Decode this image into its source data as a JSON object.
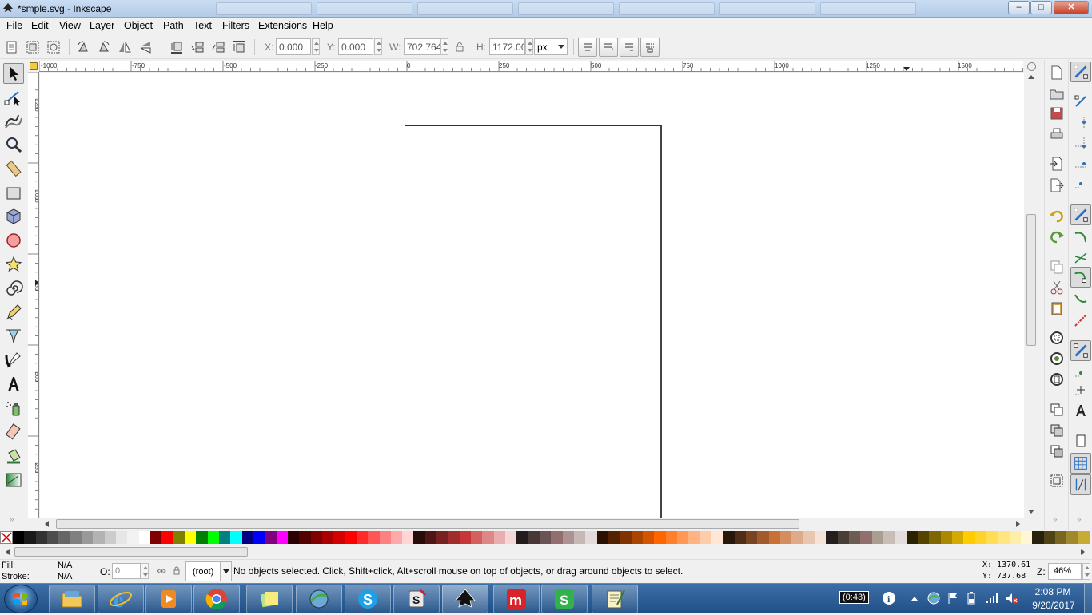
{
  "window": {
    "title": "*smple.svg - Inkscape",
    "controls": {
      "minimize": "–",
      "maximize": "□",
      "close": "✕"
    }
  },
  "menu": [
    "File",
    "Edit",
    "View",
    "Layer",
    "Object",
    "Path",
    "Text",
    "Filters",
    "Extensions",
    "Help"
  ],
  "toolbar": {
    "x_label": "X:",
    "x_value": "0.000",
    "y_label": "Y:",
    "y_value": "0.000",
    "w_label": "W:",
    "w_value": "702.764",
    "h_label": "H:",
    "h_value": "1172.00",
    "unit": "px"
  },
  "ruler": {
    "top_ticks": [
      "-1000",
      "-750",
      "-500",
      "-250",
      "0",
      "250",
      "500",
      "750",
      "1000",
      "1250",
      "1500"
    ],
    "left_ticks": [
      "1250",
      "1000",
      "750",
      "500",
      "250"
    ]
  },
  "palette": [
    "#000000",
    "#1a1a1a",
    "#333333",
    "#4d4d4d",
    "#666666",
    "#808080",
    "#999999",
    "#b3b3b3",
    "#cccccc",
    "#e6e6e6",
    "#f2f2f2",
    "#ffffff",
    "#800000",
    "#ff0000",
    "#808000",
    "#ffff00",
    "#008000",
    "#00ff00",
    "#008080",
    "#00ffff",
    "#000080",
    "#0000ff",
    "#800080",
    "#ff00ff",
    "#2b0000",
    "#550000",
    "#800000",
    "#aa0000",
    "#d40000",
    "#ff0000",
    "#ff2a2a",
    "#ff5555",
    "#ff8080",
    "#ffaaaa",
    "#ffd5d5",
    "#280b0b",
    "#501616",
    "#782121",
    "#a02c2c",
    "#c83737",
    "#d35f5f",
    "#de8787",
    "#e9afaf",
    "#f4d7d7",
    "#241c1c",
    "#483737",
    "#6c5353",
    "#916f6f",
    "#ac9393",
    "#c8b7b7",
    "#e3dbdb",
    "#2b1100",
    "#552200",
    "#803300",
    "#aa4400",
    "#d45500",
    "#ff6600",
    "#ff7f2a",
    "#ff9955",
    "#ffb380",
    "#ffccaa",
    "#ffe6d5",
    "#28170b",
    "#502d16",
    "#784421",
    "#a05a2c",
    "#c87137",
    "#d38d5f",
    "#deaa87",
    "#e9c6af",
    "#f4e3d7",
    "#241f1c",
    "#483e37",
    "#6c5d53",
    "#916f6f",
    "#ac9d93",
    "#c8beb7",
    "#e3dedb",
    "#2b2200",
    "#554400",
    "#806600",
    "#aa8800",
    "#d4aa00",
    "#ffcc00",
    "#ffd42a",
    "#ffdd55",
    "#ffe680",
    "#ffeeaa",
    "#fff6d5",
    "#28220b",
    "#504416",
    "#786721",
    "#a0892c",
    "#c8ab37"
  ],
  "status": {
    "fill_label": "Fill:",
    "fill_value": "N/A",
    "stroke_label": "Stroke:",
    "stroke_value": "N/A",
    "opacity_label": "O:",
    "opacity_value": "0",
    "layer": "(root)",
    "message": "No objects selected. Click, Shift+click, Alt+scroll mouse on top of objects, or drag around objects to select.",
    "x_coord": "X: 1370.61",
    "y_coord": "Y:  737.68",
    "zoom_label": "Z:",
    "zoom_value": "46%"
  },
  "taskbar": {
    "battery": "(0:43)",
    "time": "2:08 PM",
    "date": "9/20/2017"
  }
}
